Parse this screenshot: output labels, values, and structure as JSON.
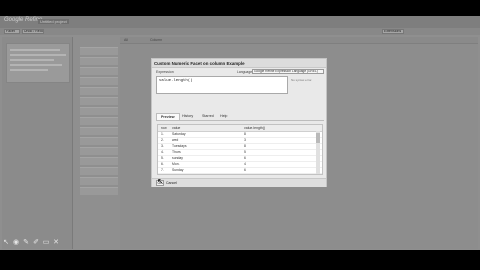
{
  "app": {
    "logo_text": "Google Refine",
    "project_name": "Untitled project"
  },
  "toolbar": {
    "items": [
      "Facet",
      "Undo / Redo",
      "Extensions"
    ]
  },
  "grid": {
    "columns": [
      "All",
      "Column"
    ]
  },
  "dialog": {
    "title": "Custom Numeric Facet on column Example",
    "expression_label": "Expression",
    "language_label": "Language",
    "language_value": "Google Refine Expression Language (GREL)",
    "expression_value": "value.length()",
    "no_syntax_error": "No syntax error.",
    "tabs": [
      "Preview",
      "History",
      "Starred",
      "Help"
    ],
    "table_headers": [
      "row",
      "value",
      "value.length()"
    ],
    "rows": [
      {
        "row": "1.",
        "value": "Saturday",
        "result": "8"
      },
      {
        "row": "2.",
        "value": "wed",
        "result": "3"
      },
      {
        "row": "3.",
        "value": "Tuesdays",
        "result": "8"
      },
      {
        "row": "4.",
        "value": "Thurs",
        "result": "5"
      },
      {
        "row": "5.",
        "value": "sunday",
        "result": "6"
      },
      {
        "row": "6.",
        "value": "Mon.",
        "result": "4"
      },
      {
        "row": "7.",
        "value": "Sunday",
        "result": "6"
      }
    ],
    "ok_label": "OK",
    "cancel_label": "Cancel"
  },
  "bottom_tools": [
    {
      "icon": "pointer-icon",
      "glyph": "↖"
    },
    {
      "icon": "record-icon",
      "glyph": "◉"
    },
    {
      "icon": "pen-icon",
      "glyph": "✎"
    },
    {
      "icon": "highlighter-icon",
      "glyph": "✐"
    },
    {
      "icon": "eraser-icon",
      "glyph": "▭"
    },
    {
      "icon": "close-icon",
      "glyph": "✕"
    }
  ],
  "colors": {
    "dim_overlay": "#8f8f8f",
    "dialog_bg": "#e9e9e9",
    "letterbox": "#000000"
  }
}
